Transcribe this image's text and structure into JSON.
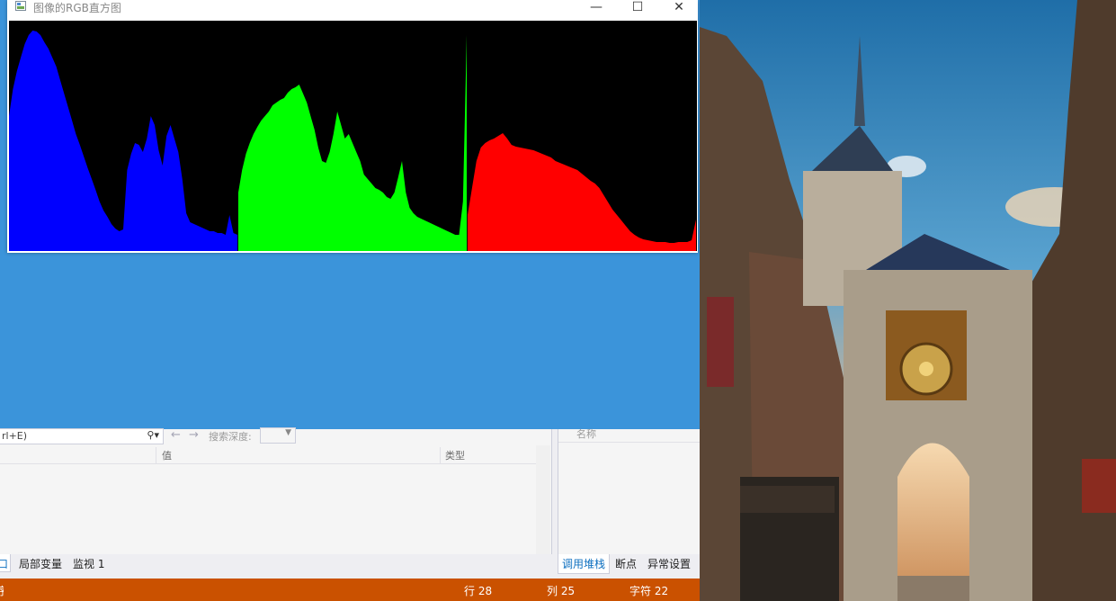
{
  "histogram_window": {
    "title": "图像的RGB直方图",
    "controls": {
      "minimize": "—",
      "maximize": "☐",
      "close": "✕"
    }
  },
  "chart_data": {
    "type": "area",
    "title": "",
    "background": "#000000",
    "series": [
      {
        "color": "#0000ff",
        "values": [
          150,
          180,
          200,
          215,
          230,
          240,
          245,
          244,
          240,
          232,
          225,
          215,
          205,
          190,
          175,
          160,
          145,
          130,
          118,
          105,
          92,
          80,
          68,
          55,
          45,
          38,
          30,
          25,
          22,
          24,
          90,
          108,
          120,
          118,
          110,
          125,
          150,
          140,
          112,
          95,
          128,
          140,
          125,
          110,
          80,
          42,
          32,
          30,
          28,
          26,
          24,
          22,
          22,
          20,
          20,
          18,
          40,
          20,
          18
        ]
      },
      {
        "color": "#00ff00",
        "values": [
          65,
          90,
          108,
          120,
          130,
          138,
          145,
          150,
          155,
          162,
          165,
          168,
          170,
          176,
          180,
          182,
          185,
          175,
          165,
          150,
          135,
          115,
          100,
          98,
          110,
          130,
          155,
          140,
          125,
          130,
          120,
          110,
          100,
          85,
          80,
          75,
          70,
          68,
          65,
          60,
          58,
          65,
          82,
          100,
          65,
          48,
          42,
          38,
          36,
          34,
          32,
          30,
          28,
          26,
          24,
          22,
          20,
          18,
          18,
          55,
          240
        ]
      },
      {
        "color": "#ff0000",
        "values": [
          40,
          70,
          100,
          115,
          120,
          123,
          125,
          128,
          131,
          125,
          118,
          116,
          115,
          114,
          113,
          112,
          110,
          108,
          106,
          104,
          100,
          98,
          96,
          94,
          92,
          90,
          86,
          82,
          78,
          75,
          70,
          62,
          54,
          46,
          40,
          34,
          28,
          22,
          18,
          15,
          13,
          12,
          11,
          10,
          10,
          10,
          9,
          9,
          10,
          10,
          10,
          12,
          35
        ]
      }
    ]
  },
  "ide": {
    "search_text": "rl+E)",
    "depth_label": "搜索深度:",
    "columns": {
      "value": "值",
      "type": "类型"
    },
    "callstack_column": "名称",
    "tabs_left": {
      "auto": "口",
      "locals": "局部变量",
      "watch": "监视 1"
    },
    "tabs_right": {
      "callstack": "调用堆栈",
      "breakpoints": "断点",
      "exceptions": "异常设置"
    },
    "status": {
      "left": "序",
      "line": "行 28",
      "col": "列 25",
      "char": "字符 22"
    }
  },
  "colors": {
    "ide_blue": "#3b94da",
    "status_orange": "#ca5100",
    "tab_active": "#0e70c0"
  }
}
